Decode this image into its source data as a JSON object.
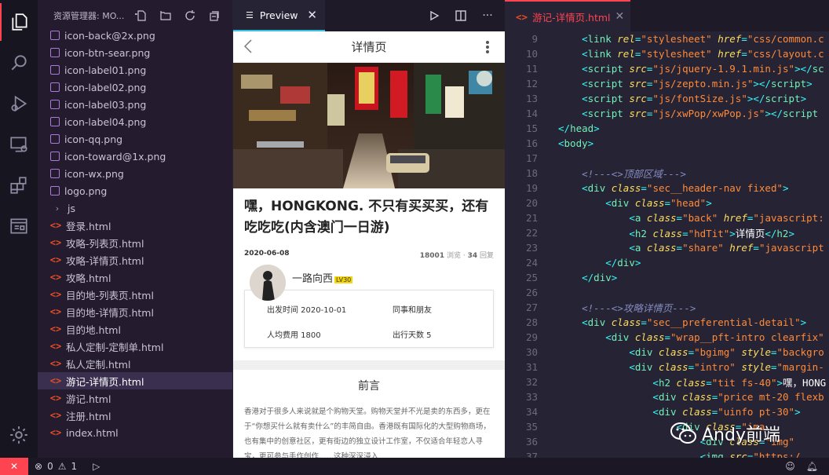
{
  "sidebar": {
    "title": "资源管理器: MO...",
    "files": [
      {
        "name": "icon-back@2x.png",
        "kind": "img"
      },
      {
        "name": "icon-btn-sear.png",
        "kind": "img"
      },
      {
        "name": "icon-label01.png",
        "kind": "img"
      },
      {
        "name": "icon-label02.png",
        "kind": "img"
      },
      {
        "name": "icon-label03.png",
        "kind": "img"
      },
      {
        "name": "icon-label04.png",
        "kind": "img"
      },
      {
        "name": "icon-qq.png",
        "kind": "img"
      },
      {
        "name": "icon-toward@1x.png",
        "kind": "img"
      },
      {
        "name": "icon-wx.png",
        "kind": "img"
      },
      {
        "name": "logo.png",
        "kind": "img"
      },
      {
        "name": "js",
        "kind": "folder"
      },
      {
        "name": "登录.html",
        "kind": "html"
      },
      {
        "name": "攻略-列表页.html",
        "kind": "html"
      },
      {
        "name": "攻略-详情页.html",
        "kind": "html"
      },
      {
        "name": "攻略.html",
        "kind": "html"
      },
      {
        "name": "目的地-列表页.html",
        "kind": "html"
      },
      {
        "name": "目的地-详情页.html",
        "kind": "html"
      },
      {
        "name": "目的地.html",
        "kind": "html"
      },
      {
        "name": "私人定制-定制单.html",
        "kind": "html"
      },
      {
        "name": "私人定制.html",
        "kind": "html"
      },
      {
        "name": "游记-详情页.html",
        "kind": "html",
        "selected": true
      },
      {
        "name": "游记.html",
        "kind": "html"
      },
      {
        "name": "注册.html",
        "kind": "html"
      },
      {
        "name": "index.html",
        "kind": "html"
      }
    ]
  },
  "preview": {
    "tab_label": "Preview",
    "page_title": "详情页",
    "article_title": "嘿，HONGKONG. 不只有买买买，还有吃吃吃(内含澳门一日游)",
    "date": "2020-06-08",
    "views": "18001",
    "views_label": "浏览",
    "replies": "34",
    "replies_label": "回复",
    "author": "一路向西",
    "level": "LV30",
    "depart": "出发时间 2020-10-01",
    "companion": "同事和朋友",
    "cost": "人均费用 1800",
    "days": "出行天数 5",
    "preface_title": "前言",
    "preface_text": "香港对于很多人来说就是个购物天堂。购物天堂并不光是卖的东西多，更在于“你想买什么就有卖什么”的丰简自由。香港既有国际化的大型购物商场，也有集中的创意社区，更有街边的独立设计工作室，不仅适合年轻恋人寻宝，更可参与手作创作……这种深深浸入"
  },
  "editor": {
    "tab_label": "游记-详情页.html",
    "lines": [
      {
        "n": "9",
        "html": "    <span class='p'>&lt;</span><span class='t'>link</span> <span class='a'>rel</span><span class='p'>=</span><span class='s'>\"stylesheet\"</span> <span class='a'>href</span><span class='p'>=</span><span class='s'>\"css/common.c</span>"
      },
      {
        "n": "10",
        "html": "    <span class='p'>&lt;</span><span class='t'>link</span> <span class='a'>rel</span><span class='p'>=</span><span class='s'>\"stylesheet\"</span> <span class='a'>href</span><span class='p'>=</span><span class='s'>\"css/layout.c</span>"
      },
      {
        "n": "11",
        "html": "    <span class='p'>&lt;</span><span class='t'>script</span> <span class='a'>src</span><span class='p'>=</span><span class='s'>\"js/jquery-1.9.1.min.js\"</span><span class='p'>&gt;&lt;/</span><span class='t'>sc</span>"
      },
      {
        "n": "12",
        "html": "    <span class='p'>&lt;</span><span class='t'>script</span> <span class='a'>src</span><span class='p'>=</span><span class='s'>\"js/zepto.min.js\"</span><span class='p'>&gt;&lt;/</span><span class='t'>script</span><span class='p'>&gt;</span>"
      },
      {
        "n": "13",
        "html": "    <span class='p'>&lt;</span><span class='t'>script</span> <span class='a'>src</span><span class='p'>=</span><span class='s'>\"js/fontSize.js\"</span><span class='p'>&gt;&lt;/</span><span class='t'>script</span><span class='p'>&gt;</span>"
      },
      {
        "n": "14",
        "html": "    <span class='p'>&lt;</span><span class='t'>script</span> <span class='a'>src</span><span class='p'>=</span><span class='s'>\"js/xwPop/xwPop.js\"</span><span class='p'>&gt;&lt;/</span><span class='t'>script</span>"
      },
      {
        "n": "15",
        "html": "<span class='p'>&lt;/</span><span class='t'>head</span><span class='p'>&gt;</span>"
      },
      {
        "n": "16",
        "html": "<span class='p'>&lt;</span><span class='t'>body</span><span class='p'>&gt;</span>"
      },
      {
        "n": "17",
        "html": ""
      },
      {
        "n": "18",
        "html": "    <span class='c'>&lt;!---&lt;&gt;顶部区域---&gt;</span>"
      },
      {
        "n": "19",
        "html": "    <span class='p'>&lt;</span><span class='t'>div</span> <span class='a'>class</span><span class='p'>=</span><span class='s'>\"sec__header-nav fixed\"</span><span class='p'>&gt;</span>"
      },
      {
        "n": "20",
        "html": "        <span class='p'>&lt;</span><span class='t'>div</span> <span class='a'>class</span><span class='p'>=</span><span class='s'>\"head\"</span><span class='p'>&gt;</span>"
      },
      {
        "n": "21",
        "html": "            <span class='p'>&lt;</span><span class='t'>a</span> <span class='a'>class</span><span class='p'>=</span><span class='s'>\"back\"</span> <span class='a'>href</span><span class='p'>=</span><span class='s'>\"javascript:</span>"
      },
      {
        "n": "22",
        "html": "            <span class='p'>&lt;</span><span class='t'>h2</span> <span class='a'>class</span><span class='p'>=</span><span class='s'>\"hdTit\"</span><span class='p'>&gt;</span><span class='w'>详情页</span><span class='p'>&lt;/</span><span class='t'>h2</span><span class='p'>&gt;</span>"
      },
      {
        "n": "23",
        "html": "            <span class='p'>&lt;</span><span class='t'>a</span> <span class='a'>class</span><span class='p'>=</span><span class='s'>\"share\"</span> <span class='a'>href</span><span class='p'>=</span><span class='s'>\"javascript</span>"
      },
      {
        "n": "24",
        "html": "        <span class='p'>&lt;/</span><span class='t'>div</span><span class='p'>&gt;</span>"
      },
      {
        "n": "25",
        "html": "    <span class='p'>&lt;/</span><span class='t'>div</span><span class='p'>&gt;</span>"
      },
      {
        "n": "26",
        "html": ""
      },
      {
        "n": "27",
        "html": "    <span class='c'>&lt;!---&lt;&gt;攻略详情页---&gt;</span>"
      },
      {
        "n": "28",
        "html": "    <span class='p'>&lt;</span><span class='t'>div</span> <span class='a'>class</span><span class='p'>=</span><span class='s'>\"sec__preferential-detail\"</span><span class='p'>&gt;</span>"
      },
      {
        "n": "29",
        "html": "        <span class='p'>&lt;</span><span class='t'>div</span> <span class='a'>class</span><span class='p'>=</span><span class='s'>\"wrap__pft-intro clearfix\"</span>"
      },
      {
        "n": "30",
        "html": "            <span class='p'>&lt;</span><span class='t'>div</span> <span class='a'>class</span><span class='p'>=</span><span class='s'>\"bgimg\"</span> <span class='a'>style</span><span class='p'>=</span><span class='s'>\"backgro</span>"
      },
      {
        "n": "31",
        "html": "            <span class='p'>&lt;</span><span class='t'>div</span> <span class='a'>class</span><span class='p'>=</span><span class='s'>\"intro\"</span> <span class='a'>style</span><span class='p'>=</span><span class='s'>\"margin-</span>"
      },
      {
        "n": "32",
        "html": "                <span class='p'>&lt;</span><span class='t'>h2</span> <span class='a'>class</span><span class='p'>=</span><span class='s'>\"tit fs-40\"</span><span class='p'>&gt;</span><span class='w'>嘿，HONG</span>"
      },
      {
        "n": "33",
        "html": "                <span class='p'>&lt;</span><span class='t'>div</span> <span class='a'>class</span><span class='p'>=</span><span class='s'>\"price mt-20 flexb</span>"
      },
      {
        "n": "34",
        "html": "                <span class='p'>&lt;</span><span class='t'>div</span> <span class='a'>class</span><span class='p'>=</span><span class='s'>\"uinfo pt-30\"</span><span class='p'>&gt;</span>"
      },
      {
        "n": "35",
        "html": "                    <span class='p'>&lt;</span><span class='t'>div</span> <span class='a'>class</span><span class='p'>=</span><span class='s'>\"ima</span>"
      },
      {
        "n": "36",
        "html": "                        <span class='p'>&lt;</span><span class='t'>div</span> <span class='a'>class</span><span class='p'>=</span><span class='s'>\"img\"</span>"
      },
      {
        "n": "37",
        "html": "                        <span class='p'>&lt;</span><span class='t'>img</span> <span class='a'>src</span><span class='p'>=</span><span class='s'>\"https:/</span>"
      }
    ]
  },
  "status": {
    "errors": "0",
    "warnings": "1"
  },
  "watermark": "Andy前端"
}
